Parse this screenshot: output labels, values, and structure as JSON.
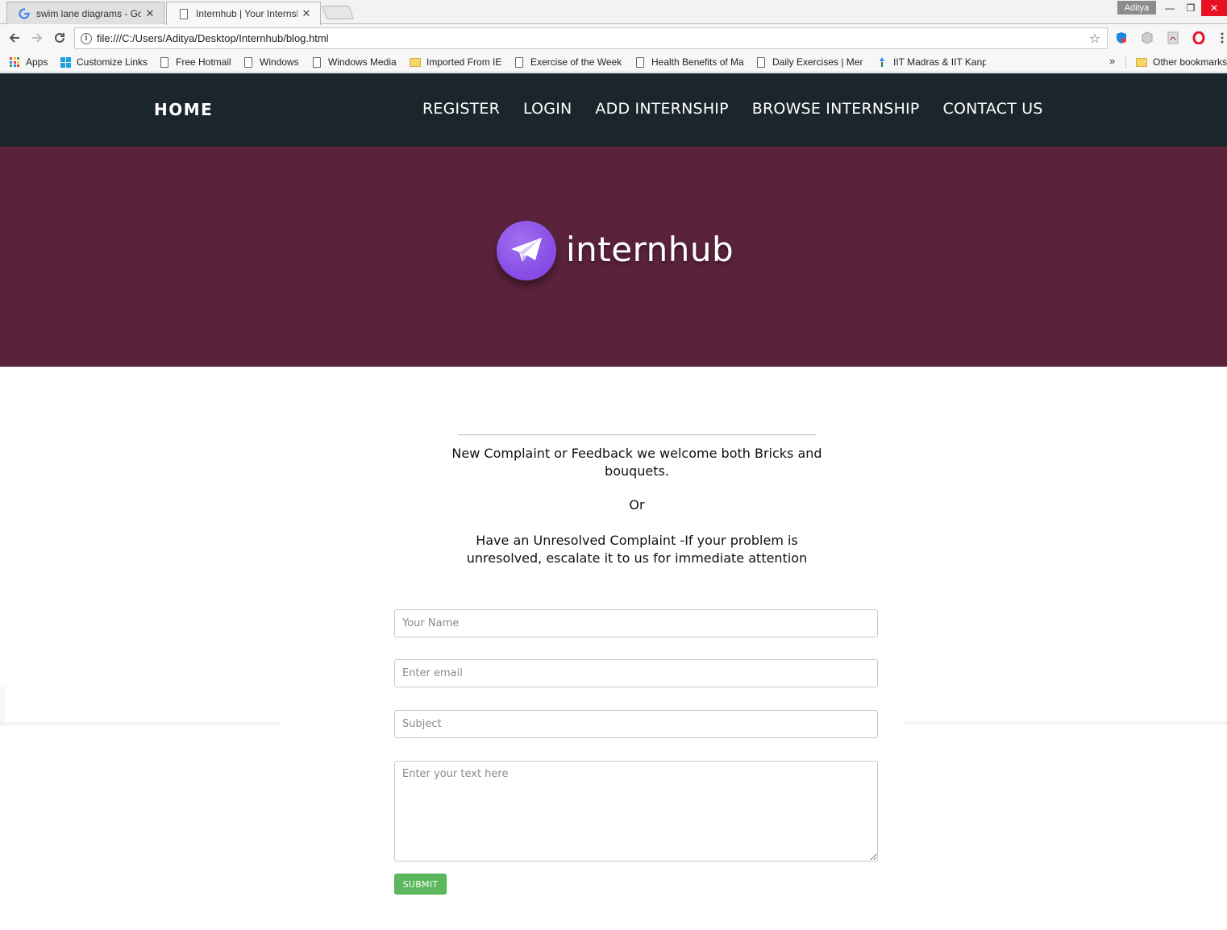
{
  "browser": {
    "tabs": [
      {
        "title": "swim lane diagrams - Go",
        "active": false
      },
      {
        "title": "Internhub | Your Internsh",
        "active": true
      }
    ],
    "profile_name": "Aditya",
    "url": "file:///C:/Users/Aditya/Desktop/Internhub/blog.html",
    "bookmarks": [
      {
        "label": "Apps",
        "icon": "apps-icon"
      },
      {
        "label": "Customize Links",
        "icon": "windows-logo-icon"
      },
      {
        "label": "Free Hotmail",
        "icon": "page-icon"
      },
      {
        "label": "Windows",
        "icon": "page-icon"
      },
      {
        "label": "Windows Media",
        "icon": "page-icon"
      },
      {
        "label": "Imported From IE",
        "icon": "folder-icon"
      },
      {
        "label": "Exercise of the Week",
        "icon": "page-icon"
      },
      {
        "label": "Health Benefits of Ma",
        "icon": "page-icon"
      },
      {
        "label": "Daily Exercises | Men",
        "icon": "page-icon"
      },
      {
        "label": "IIT Madras & IIT Kanp",
        "icon": "iit-icon"
      }
    ],
    "overflow_label": "»",
    "other_bookmarks": "Other bookmarks"
  },
  "site": {
    "brand": "HOME",
    "nav": [
      "REGISTER",
      "LOGIN",
      "ADD INTERNSHIP",
      "BROWSE INTERNSHIP",
      "CONTACT US"
    ],
    "logo_text": "internhub",
    "colors": {
      "nav_bg": "#1b262c",
      "hero_bg": "#5b233b",
      "logo_purple": "#8a4fe6",
      "submit_green": "#5cb85c"
    }
  },
  "form": {
    "intro1": "New Complaint or Feedback we welcome both Bricks and bouquets.",
    "intro_or": "Or",
    "intro2": "Have an Unresolved Complaint -If your problem is unresolved, escalate it to us for immediate attention",
    "name_placeholder": "Your Name",
    "email_placeholder": "Enter email",
    "subject_placeholder": "Subject",
    "text_placeholder": "Enter your text here",
    "submit_label": "SUBMIT"
  }
}
